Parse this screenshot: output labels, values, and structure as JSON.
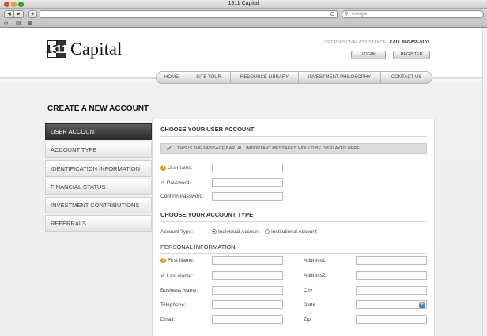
{
  "browser": {
    "window_title": "1311 Capital",
    "nav_back": "◀",
    "nav_forward": "▶",
    "new_tab": "+",
    "reload": "C",
    "search_placeholder": "Google",
    "search_icon": "magnifier-icon",
    "bookmark_icons": [
      "reading-glasses-icon",
      "book-icon",
      "grid-icon"
    ]
  },
  "header": {
    "logo_mark": [
      "13",
      "11"
    ],
    "logo_text": "Capital",
    "assistance_label": "GET PERSONAL ASSISTANCE .",
    "assistance_phone": "CALL 866-855-9102",
    "login_label": "LOGIN",
    "register_label": "REGISTER"
  },
  "nav": {
    "items": [
      "HOME",
      "SITE TOUR",
      "RESOURCE LIBRARY",
      "INVESTMENT PHILOSOPHY",
      "CONTACT US"
    ]
  },
  "page": {
    "title": "CREATE A NEW ACCOUNT"
  },
  "sidebar": {
    "items": [
      {
        "label": "USER ACCOUNT",
        "active": true
      },
      {
        "label": "ACCOUNT TYPE"
      },
      {
        "label": "IDENTIFICATION INFORMATION"
      },
      {
        "label": "FINANCIAL STATUS"
      },
      {
        "label": "INVESTMENT CONTRIBUTIONS"
      },
      {
        "label": "REFERRALS"
      }
    ]
  },
  "form": {
    "user_account_heading": "CHOOSE YOUR USER ACCOUNT",
    "message_bar": "THIS IS THE MESSAGE BAR. ALL IMPORTANT MESSAGES WOULD BE DISPLAYED HERE.",
    "username_label": "Username:",
    "password_label": "Password:",
    "confirm_password_label": "Confirm Password:",
    "account_type_heading": "CHOOSE YOUR ACCOUNT TYPE",
    "account_type_label": "Account Type:",
    "individual_label": "Individual Account",
    "institutional_label": "Institutional Account",
    "personal_heading": "PERSONAL INFORMATION",
    "first_name_label": "First Name:",
    "last_name_label": "Last Name:",
    "business_name_label": "Business Name:",
    "telephone_label": "Telephone:",
    "email_label": "Email:",
    "address1_label": "Address1:",
    "address2_label": "Address2:",
    "city_label": "City",
    "state_label": "State",
    "zip_label": "Zip"
  },
  "colors": {
    "sidebar_active": "#2a2a2a",
    "success_green": "#4a9e2a",
    "warning_orange": "#e69a1a"
  }
}
